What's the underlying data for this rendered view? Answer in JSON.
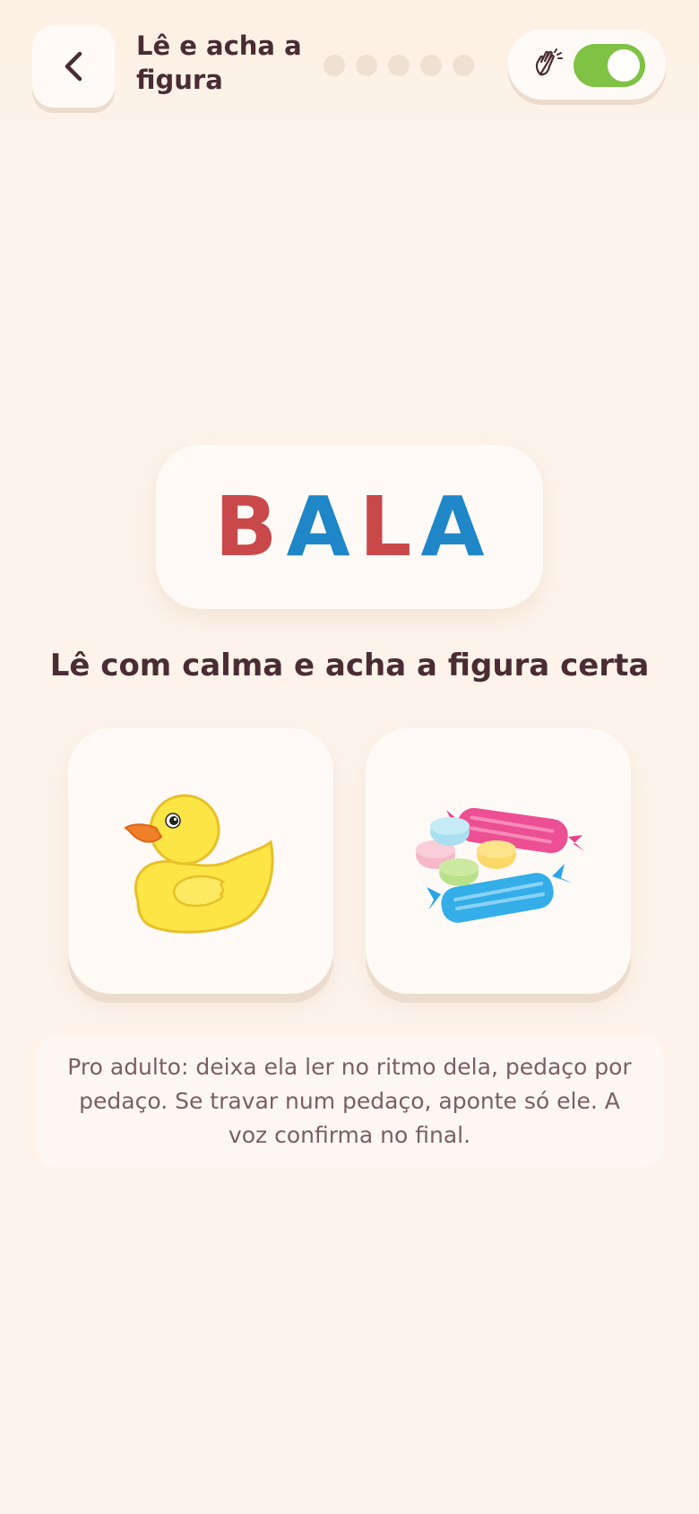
{
  "header": {
    "title": "Lê e acha a figura",
    "progress": {
      "total": 5,
      "completed": 0
    }
  },
  "sound_toggle": {
    "icon": "wave-hand-icon",
    "enabled": true,
    "color_on": "#7fc244"
  },
  "word": {
    "text": "BALA",
    "syllables": [
      {
        "text": "BA",
        "colors": [
          "#c9494b",
          "#1f87c8"
        ]
      },
      {
        "text": "LA",
        "colors": [
          "#c9494b",
          "#1f87c8"
        ]
      }
    ],
    "letters": [
      {
        "ch": "B",
        "color": "#c9494b"
      },
      {
        "ch": "A",
        "color": "#1f87c8"
      },
      {
        "ch": "L",
        "color": "#c9494b"
      },
      {
        "ch": "A",
        "color": "#1f87c8"
      }
    ]
  },
  "instruction": "Lê com calma e acha a figura certa",
  "options": [
    {
      "icon": "rubber-duck-icon"
    },
    {
      "icon": "candies-icon"
    }
  ],
  "hint": "Pro adulto: deixa ela ler no ritmo dela, pedaço por pedaço. Se travar num pedaço, aponte só ele. A voz confirma no final."
}
